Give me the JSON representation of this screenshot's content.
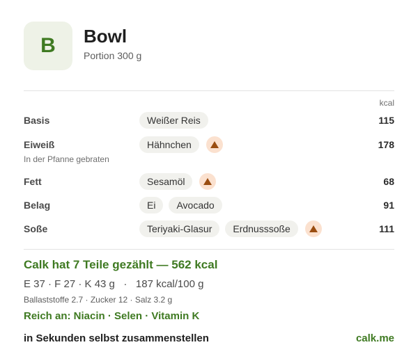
{
  "header": {
    "avatar_letter": "B",
    "title": "Bowl",
    "portion": "Portion 300 g"
  },
  "unit_label": "kcal",
  "rows": [
    {
      "label": "Basis",
      "sub": "",
      "chips": [
        "Weißer Reis"
      ],
      "warning": false,
      "kcal": "115"
    },
    {
      "label": "Eiweiß",
      "sub": "In der Pfanne gebraten",
      "chips": [
        "Hähnchen"
      ],
      "warning": true,
      "kcal": "178"
    },
    {
      "label": "Fett",
      "sub": "",
      "chips": [
        "Sesamöl"
      ],
      "warning": true,
      "kcal": "68"
    },
    {
      "label": "Belag",
      "sub": "",
      "chips": [
        "Ei",
        "Avocado"
      ],
      "warning": false,
      "kcal": "91"
    },
    {
      "label": "Soße",
      "sub": "",
      "chips": [
        "Teriyaki-Glasur",
        "Erdnusssoße"
      ],
      "warning": true,
      "kcal": "111"
    }
  ],
  "summary": {
    "headline": "Calk hat 7 Teile gezählt — 562 kcal",
    "macros": "E 37 · F 27 · K 43 g   ·   187 kcal/100 g",
    "details": "Ballaststoffe 2.7 · Zucker 12 · Salz 3.2 g",
    "rich_in": "Reich an: Niacin · Selen · Vitamin K"
  },
  "footer": {
    "cta": "in Sekunden selbst zusammenstellen",
    "link": "calk.me"
  },
  "colors": {
    "accent": "#3f7a22",
    "warning_bg": "#fbe1cf",
    "warning_icon": "#9a4d10",
    "chip_bg": "#f1f1ed"
  }
}
